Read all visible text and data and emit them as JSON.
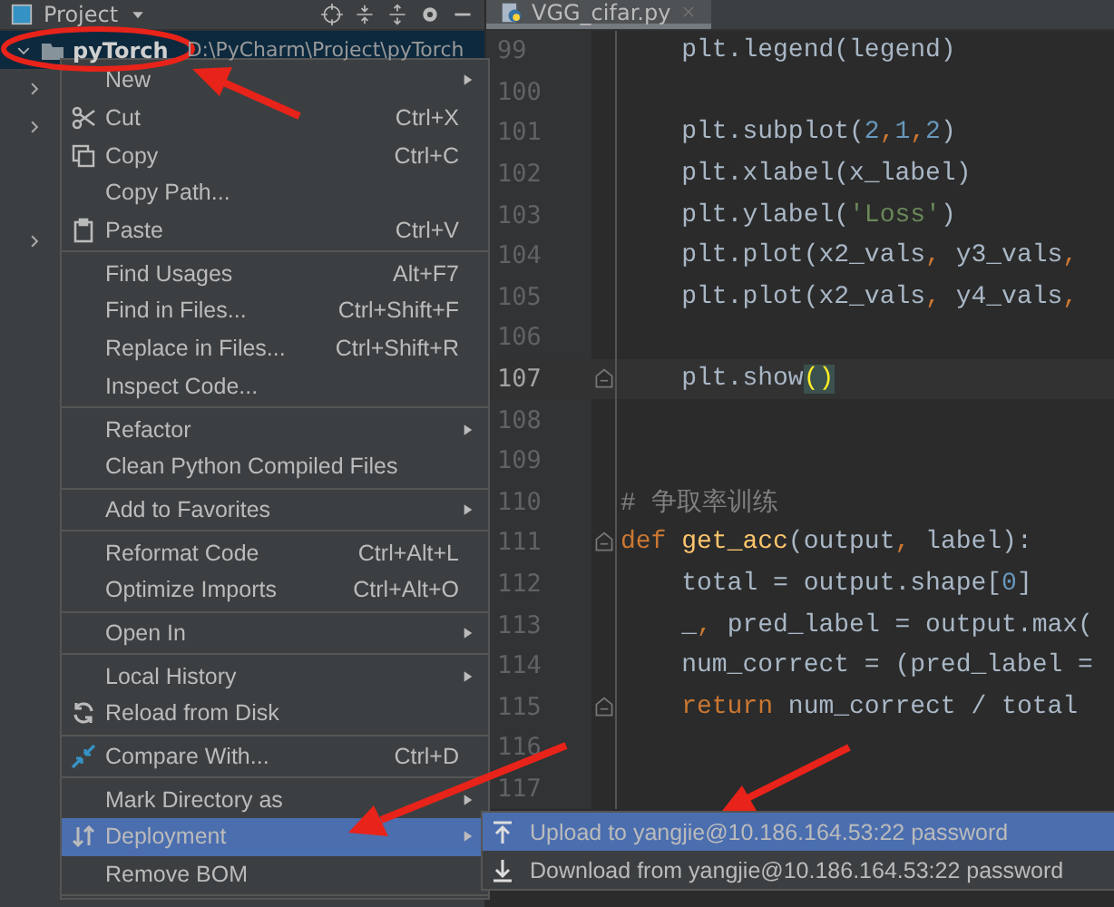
{
  "project_panel": {
    "title": "Project",
    "root": {
      "name": "pyTorch",
      "path": "D:\\PyCharm\\Project\\pyTorch",
      "expanded": true,
      "selected": true
    }
  },
  "editor": {
    "tab": {
      "label": "VGG_cifar.py",
      "selected": true
    },
    "lines": [
      {
        "number": "99",
        "current": false,
        "tokens": [
          {
            "kind": "plain",
            "text": "    plt.legend(legend)"
          }
        ]
      },
      {
        "number": "100",
        "current": false
      },
      {
        "number": "101",
        "current": false,
        "tokens": [
          {
            "kind": "plain",
            "text": "    plt.subplot("
          },
          {
            "kind": "number",
            "text": "2"
          },
          {
            "kind": "keyword",
            "text": ","
          },
          {
            "kind": "number",
            "text": "1"
          },
          {
            "kind": "keyword",
            "text": ","
          },
          {
            "kind": "number",
            "text": "2"
          },
          {
            "kind": "plain",
            "text": ")"
          }
        ]
      },
      {
        "number": "102",
        "current": false,
        "tokens": [
          {
            "kind": "plain",
            "text": "    plt.xlabel(x_label)"
          }
        ]
      },
      {
        "number": "103",
        "current": false,
        "tokens": [
          {
            "kind": "plain",
            "text": "    plt.ylabel("
          },
          {
            "kind": "string",
            "text": "'Loss'"
          },
          {
            "kind": "plain",
            "text": ")"
          }
        ]
      },
      {
        "number": "104",
        "current": false,
        "tokens": [
          {
            "kind": "plain",
            "text": "    plt.plot(x2_vals"
          },
          {
            "kind": "keyword",
            "text": ", "
          },
          {
            "kind": "plain",
            "text": "y3_vals"
          },
          {
            "kind": "keyword",
            "text": ","
          }
        ]
      },
      {
        "number": "105",
        "current": false,
        "tokens": [
          {
            "kind": "plain",
            "text": "    plt.plot(x2_vals"
          },
          {
            "kind": "keyword",
            "text": ", "
          },
          {
            "kind": "plain",
            "text": "y4_vals"
          },
          {
            "kind": "keyword",
            "text": ","
          }
        ]
      },
      {
        "number": "106",
        "current": false
      },
      {
        "number": "107",
        "fold": true,
        "current": true,
        "tokens": [
          {
            "kind": "plain",
            "text": "    plt.show"
          },
          {
            "kind": "bracket",
            "text": "()"
          }
        ]
      },
      {
        "number": "108",
        "current": false
      },
      {
        "number": "109",
        "current": false
      },
      {
        "number": "110",
        "current": false,
        "tokens": [
          {
            "kind": "comment",
            "text": "# 争取率训练"
          }
        ]
      },
      {
        "number": "111",
        "fold": true,
        "current": false,
        "tokens": [
          {
            "kind": "keyword",
            "text": "def "
          },
          {
            "kind": "func",
            "text": "get_acc"
          },
          {
            "kind": "plain",
            "text": "(output"
          },
          {
            "kind": "keyword",
            "text": ", "
          },
          {
            "kind": "plain",
            "text": "label):"
          }
        ]
      },
      {
        "number": "112",
        "current": false,
        "tokens": [
          {
            "kind": "plain",
            "text": "    total = output.shape["
          },
          {
            "kind": "number",
            "text": "0"
          },
          {
            "kind": "plain",
            "text": "]"
          }
        ]
      },
      {
        "number": "113",
        "current": false,
        "tokens": [
          {
            "kind": "plain",
            "text": "    _"
          },
          {
            "kind": "keyword",
            "text": ", "
          },
          {
            "kind": "plain",
            "text": "pred_label = output.max("
          }
        ]
      },
      {
        "number": "114",
        "current": false,
        "tokens": [
          {
            "kind": "plain",
            "text": "    num_correct = (pred_label ="
          }
        ]
      },
      {
        "number": "115",
        "fold": true,
        "current": false,
        "tokens": [
          {
            "kind": "keyword",
            "text": "    return "
          },
          {
            "kind": "plain",
            "text": "num_correct / total"
          }
        ]
      },
      {
        "number": "116",
        "current": false
      },
      {
        "number": "117",
        "current": false
      }
    ]
  },
  "context_menu": {
    "items": [
      {
        "label": "New",
        "submenu": true,
        "selected": false
      },
      {
        "label": "Cut",
        "shortcut": "Ctrl+X",
        "selected": false
      },
      {
        "label": "Copy",
        "shortcut": "Ctrl+C",
        "selected": false
      },
      {
        "label": "Copy Path...",
        "selected": false
      },
      {
        "label": "Paste",
        "shortcut": "Ctrl+V",
        "selected": false,
        "separator_after": true
      },
      {
        "label": "Find Usages",
        "shortcut": "Alt+F7",
        "selected": false
      },
      {
        "label": "Find in Files...",
        "shortcut": "Ctrl+Shift+F",
        "selected": false
      },
      {
        "label": "Replace in Files...",
        "shortcut": "Ctrl+Shift+R",
        "selected": false
      },
      {
        "label": "Inspect Code...",
        "selected": false,
        "separator_after": true
      },
      {
        "label": "Refactor",
        "submenu": true,
        "selected": false
      },
      {
        "label": "Clean Python Compiled Files",
        "selected": false,
        "separator_after": true
      },
      {
        "label": "Add to Favorites",
        "submenu": true,
        "selected": false,
        "separator_after": true
      },
      {
        "label": "Reformat Code",
        "shortcut": "Ctrl+Alt+L",
        "selected": false
      },
      {
        "label": "Optimize Imports",
        "shortcut": "Ctrl+Alt+O",
        "selected": false,
        "separator_after": true
      },
      {
        "label": "Open In",
        "submenu": true,
        "selected": false,
        "separator_after": true
      },
      {
        "label": "Local History",
        "submenu": true,
        "selected": false
      },
      {
        "label": "Reload from Disk",
        "selected": false,
        "separator_after": true
      },
      {
        "label": "Compare With...",
        "shortcut": "Ctrl+D",
        "selected": false,
        "separator_after": true
      },
      {
        "label": "Mark Directory as",
        "submenu": true,
        "selected": false
      },
      {
        "label": "Deployment",
        "submenu": true,
        "selected": true
      },
      {
        "label": "Remove BOM",
        "selected": false,
        "separator_after": true
      }
    ]
  },
  "deployment_submenu": {
    "items": [
      {
        "label": "Upload to yangjie@10.186.164.53:22 password",
        "selected": true
      },
      {
        "label": "Download from yangjie@10.186.164.53:22 password",
        "selected": false
      }
    ]
  }
}
